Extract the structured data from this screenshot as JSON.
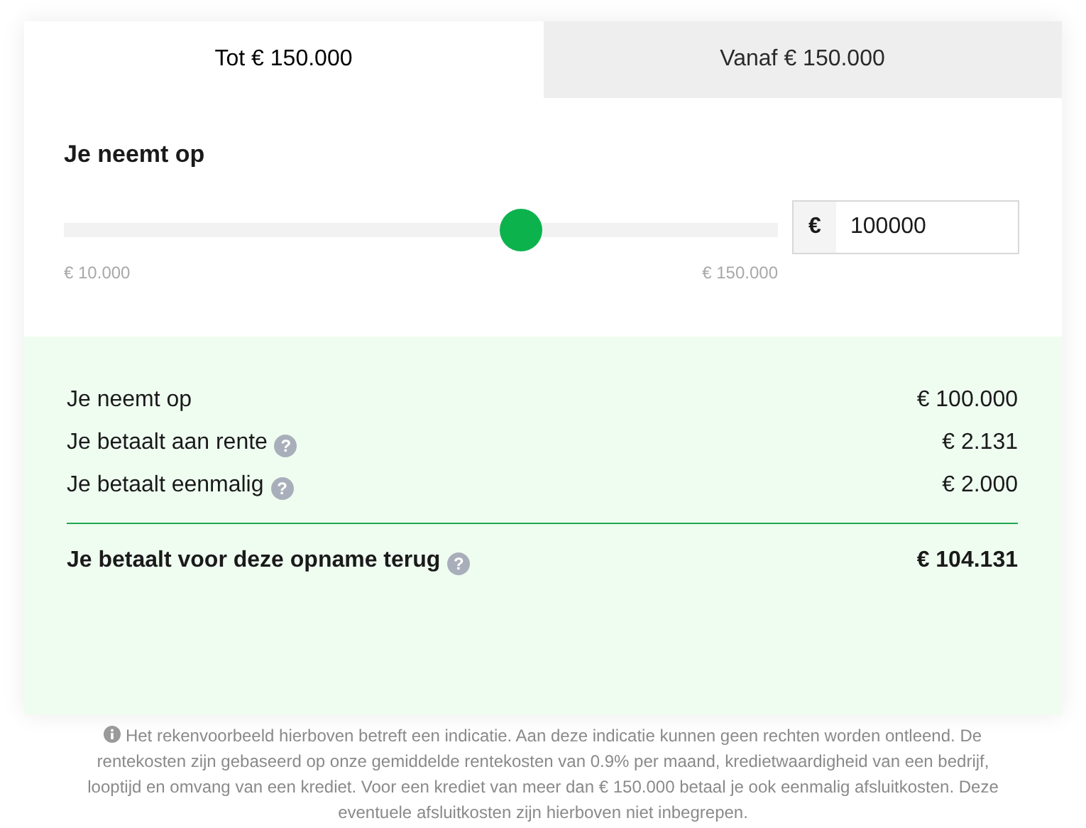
{
  "tabs": [
    {
      "label": "Tot € 150.000",
      "selected": true
    },
    {
      "label": "Vanaf € 150.000",
      "selected": false
    }
  ],
  "amount": {
    "title": "Je neemt op",
    "level": 0.64,
    "min_label": "€ 10.000",
    "max_label": "€ 150.000",
    "currency": "€",
    "value": "100000"
  },
  "summary": {
    "rows": [
      {
        "label": "Je neemt op",
        "value": "€ 100.000"
      },
      {
        "label": "Je betaalt aan rente",
        "hint": "?",
        "value": "€ 2.131"
      },
      {
        "label": "Je betaalt eenmalig",
        "hint": "?",
        "value": "€ 2.000"
      }
    ],
    "total": {
      "label": "Je betaalt voor deze opname terug",
      "hint": "?",
      "value": "€ 104.131"
    }
  },
  "footnote": "Het rekenvoorbeeld hierboven betreft een indicatie. Aan deze indicatie kunnen geen rechten worden ontleend. De rentekosten zijn gebaseerd op onze gemiddelde rentekosten van 0.9% per maand, kredietwaardigheid van een bedrijf, looptijd en omvang van een krediet. Voor een krediet van meer dan € 150.000 betaal je ook eenmalig afsluitkosten. Deze eventuele afsluitkosten zijn hierboven niet inbegrepen."
}
